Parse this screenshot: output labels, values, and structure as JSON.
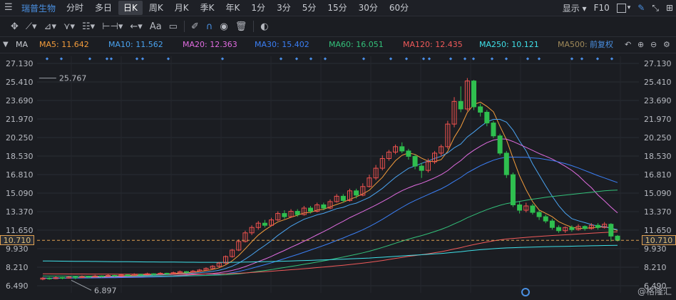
{
  "period_bar": {
    "stock_name": "瑞普生物",
    "tabs": [
      "分时",
      "多日",
      "日K",
      "周K",
      "月K",
      "季K",
      "年K",
      "1分",
      "3分",
      "5分",
      "15分",
      "30分",
      "60分"
    ],
    "active_tab": "日K",
    "display_label": "显示",
    "f10_label": "F10"
  },
  "toolbar": {
    "text_tool_label": "Aa"
  },
  "ma_bar": {
    "indicator_label": "MA",
    "items": [
      {
        "label": "MA5: 11.642",
        "color": "#f39c3c"
      },
      {
        "label": "MA10: 11.562",
        "color": "#4aa3f0"
      },
      {
        "label": "MA20: 12.363",
        "color": "#e06ce0"
      },
      {
        "label": "MA30: 15.402",
        "color": "#3b7ff5"
      },
      {
        "label": "MA60: 16.051",
        "color": "#33c17a"
      },
      {
        "label": "MA120: 12.435",
        "color": "#f05a5a"
      },
      {
        "label": "MA250: 10.121",
        "color": "#3fe0e8"
      },
      {
        "label": "MA500:",
        "color": "#a08a5a"
      }
    ],
    "adjust_label": "前复权"
  },
  "price_axis": {
    "ticks": [
      "27.130",
      "25.410",
      "23.690",
      "21.970",
      "20.250",
      "18.530",
      "16.810",
      "15.090",
      "13.370",
      "11.650",
      "9.930",
      "8.210",
      "6.490"
    ],
    "current_price": "10.710"
  },
  "annotations": {
    "high_label": "25.767",
    "low_label": "6.897"
  },
  "watermark": "@格隆汇",
  "chart_data": {
    "type": "candlestick",
    "ylim": [
      6.49,
      27.13
    ],
    "high": 25.767,
    "low": 6.897,
    "last": 10.71,
    "candles": [
      [
        7.1,
        7.2,
        7.3,
        7.0
      ],
      [
        7.2,
        7.15,
        7.3,
        7.05
      ],
      [
        7.15,
        7.25,
        7.35,
        7.1
      ],
      [
        7.25,
        7.2,
        7.3,
        7.1
      ],
      [
        7.2,
        7.3,
        7.4,
        7.15
      ],
      [
        7.3,
        7.25,
        7.35,
        7.1
      ],
      [
        7.25,
        7.35,
        7.45,
        7.2
      ],
      [
        7.35,
        7.3,
        7.4,
        7.2
      ],
      [
        7.3,
        7.4,
        7.5,
        7.25
      ],
      [
        7.4,
        7.35,
        7.45,
        7.25
      ],
      [
        7.35,
        7.45,
        7.55,
        7.3
      ],
      [
        7.45,
        7.4,
        7.5,
        7.3
      ],
      [
        7.4,
        7.5,
        7.6,
        7.35
      ],
      [
        7.5,
        7.45,
        7.55,
        7.35
      ],
      [
        7.45,
        7.55,
        7.65,
        7.4
      ],
      [
        7.55,
        7.5,
        7.6,
        7.4
      ],
      [
        7.5,
        7.6,
        7.7,
        7.45
      ],
      [
        7.6,
        7.55,
        7.65,
        7.45
      ],
      [
        7.55,
        7.65,
        7.75,
        7.5
      ],
      [
        7.65,
        7.6,
        7.7,
        7.5
      ],
      [
        7.6,
        7.7,
        7.8,
        7.55
      ],
      [
        7.7,
        7.8,
        7.9,
        7.65
      ],
      [
        7.8,
        7.75,
        7.85,
        7.65
      ],
      [
        7.75,
        7.85,
        7.95,
        7.7
      ],
      [
        7.85,
        7.95,
        8.05,
        7.8
      ],
      [
        7.95,
        8.1,
        8.2,
        7.9
      ],
      [
        8.1,
        8.3,
        8.4,
        8.0
      ],
      [
        8.3,
        8.6,
        8.7,
        8.2
      ],
      [
        8.6,
        9.2,
        9.3,
        8.5
      ],
      [
        9.2,
        9.8,
        9.9,
        9.1
      ],
      [
        9.8,
        10.6,
        10.8,
        9.7
      ],
      [
        10.6,
        11.4,
        11.6,
        10.5
      ],
      [
        11.4,
        11.9,
        12.1,
        11.2
      ],
      [
        11.9,
        12.3,
        12.5,
        11.7
      ],
      [
        12.3,
        12.1,
        12.6,
        11.9
      ],
      [
        12.1,
        12.6,
        12.8,
        12.0
      ],
      [
        12.6,
        13.2,
        13.4,
        12.5
      ],
      [
        13.2,
        12.9,
        13.5,
        12.7
      ],
      [
        12.9,
        13.4,
        13.6,
        12.8
      ],
      [
        13.4,
        13.1,
        13.6,
        12.9
      ],
      [
        13.1,
        13.7,
        13.9,
        13.0
      ],
      [
        13.7,
        13.4,
        13.9,
        13.2
      ],
      [
        13.4,
        14.0,
        14.2,
        13.3
      ],
      [
        14.0,
        13.7,
        14.2,
        13.5
      ],
      [
        13.7,
        14.3,
        14.5,
        13.6
      ],
      [
        14.3,
        14.8,
        15.0,
        14.2
      ],
      [
        14.8,
        14.4,
        15.0,
        14.2
      ],
      [
        14.4,
        15.3,
        15.5,
        14.3
      ],
      [
        15.3,
        14.9,
        15.5,
        14.6
      ],
      [
        14.9,
        15.7,
        16.0,
        14.8
      ],
      [
        15.7,
        16.5,
        16.8,
        15.6
      ],
      [
        16.5,
        17.4,
        17.7,
        16.3
      ],
      [
        17.4,
        18.3,
        18.6,
        17.2
      ],
      [
        18.3,
        18.9,
        19.1,
        18.1
      ],
      [
        18.9,
        19.4,
        19.6,
        18.7
      ],
      [
        19.4,
        19.0,
        19.8,
        18.8
      ],
      [
        19.0,
        18.5,
        19.2,
        18.2
      ],
      [
        18.5,
        17.6,
        18.7,
        17.3
      ],
      [
        17.6,
        17.2,
        17.9,
        16.5
      ],
      [
        17.2,
        18.0,
        18.3,
        17.0
      ],
      [
        18.0,
        18.8,
        19.0,
        17.8
      ],
      [
        18.8,
        19.4,
        19.6,
        18.5
      ],
      [
        19.4,
        21.5,
        21.8,
        19.2
      ],
      [
        21.5,
        23.6,
        24.0,
        21.2
      ],
      [
        23.6,
        22.9,
        25.0,
        22.6
      ],
      [
        22.9,
        25.5,
        25.77,
        22.7
      ],
      [
        25.5,
        23.1,
        25.6,
        22.8
      ],
      [
        23.1,
        22.6,
        23.4,
        22.2
      ],
      [
        22.6,
        21.6,
        22.8,
        21.3
      ],
      [
        21.6,
        20.4,
        21.8,
        20.2
      ],
      [
        20.4,
        18.8,
        20.6,
        18.6
      ],
      [
        18.8,
        16.8,
        19.0,
        16.5
      ],
      [
        16.8,
        14.0,
        17.0,
        13.8
      ],
      [
        14.0,
        13.5,
        14.3,
        13.2
      ],
      [
        13.5,
        13.9,
        14.2,
        13.3
      ],
      [
        13.9,
        13.3,
        14.1,
        13.1
      ],
      [
        13.3,
        12.9,
        13.5,
        12.6
      ],
      [
        12.9,
        12.5,
        13.1,
        12.3
      ],
      [
        12.5,
        11.9,
        12.7,
        11.7
      ],
      [
        11.9,
        11.6,
        12.1,
        11.4
      ],
      [
        11.6,
        11.9,
        12.0,
        11.4
      ],
      [
        11.9,
        11.7,
        12.1,
        11.5
      ],
      [
        11.7,
        12.0,
        12.2,
        11.6
      ],
      [
        12.0,
        11.8,
        12.1,
        11.6
      ],
      [
        11.8,
        12.1,
        12.3,
        11.7
      ],
      [
        12.1,
        11.9,
        12.3,
        11.7
      ],
      [
        11.9,
        12.2,
        12.4,
        11.8
      ],
      [
        12.2,
        11.1,
        12.3,
        10.6
      ],
      [
        11.1,
        10.71,
        11.2,
        10.6
      ]
    ]
  }
}
